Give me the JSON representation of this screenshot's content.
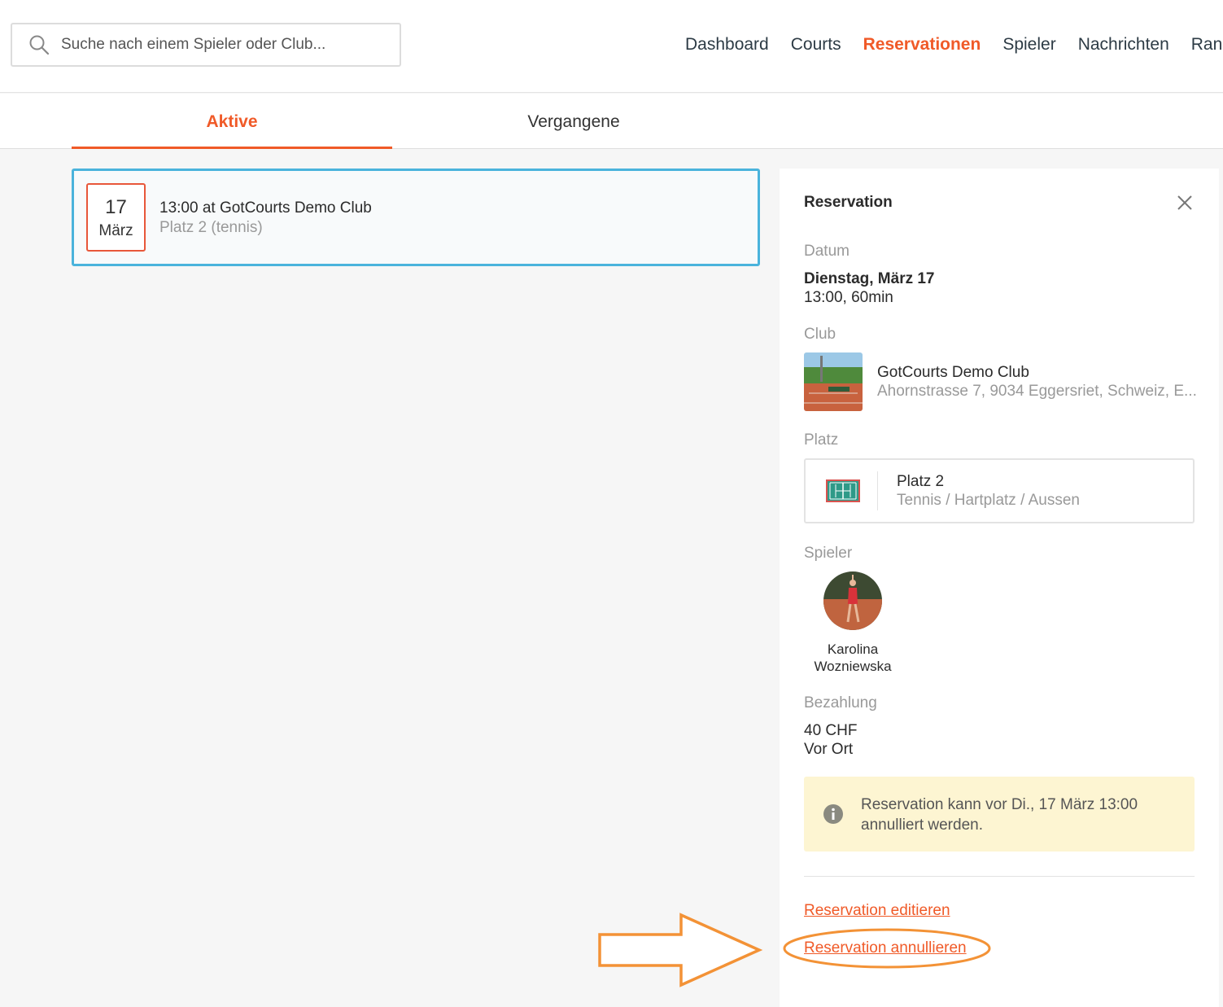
{
  "search": {
    "placeholder": "Suche nach einem Spieler oder Club..."
  },
  "nav": {
    "items": [
      "Dashboard",
      "Courts",
      "Reservationen",
      "Spieler",
      "Nachrichten",
      "Rang"
    ],
    "active": "Reservationen"
  },
  "tabs": {
    "active": "Aktive",
    "past": "Vergangene"
  },
  "reservation_card": {
    "day": "17",
    "month": "März",
    "title": "13:00 at GotCourts Demo Club",
    "subtitle": "Platz 2 (tennis)"
  },
  "panel": {
    "title": "Reservation",
    "date_label": "Datum",
    "date_value": "Dienstag, März 17",
    "time_value": "13:00, 60min",
    "club_label": "Club",
    "club_name": "GotCourts Demo Club",
    "club_address": "Ahornstrasse 7, 9034 Eggersriet, Schweiz, E...",
    "court_label": "Platz",
    "court_name": "Platz 2",
    "court_type": "Tennis / Hartplatz / Aussen",
    "player_label": "Spieler",
    "player_first": "Karolina",
    "player_last": "Wozniewska",
    "payment_label": "Bezahlung",
    "payment_amount": "40 CHF",
    "payment_method": "Vor Ort",
    "info_text": "Reservation kann vor Di., 17 März 13:00 annulliert werden.",
    "edit_link": "Reservation editieren",
    "cancel_link": "Reservation annullieren"
  },
  "colors": {
    "accent": "#f05a28",
    "selected_border": "#4ab3dc",
    "annotation": "#f39236",
    "info_bg": "#fdf5d2"
  }
}
